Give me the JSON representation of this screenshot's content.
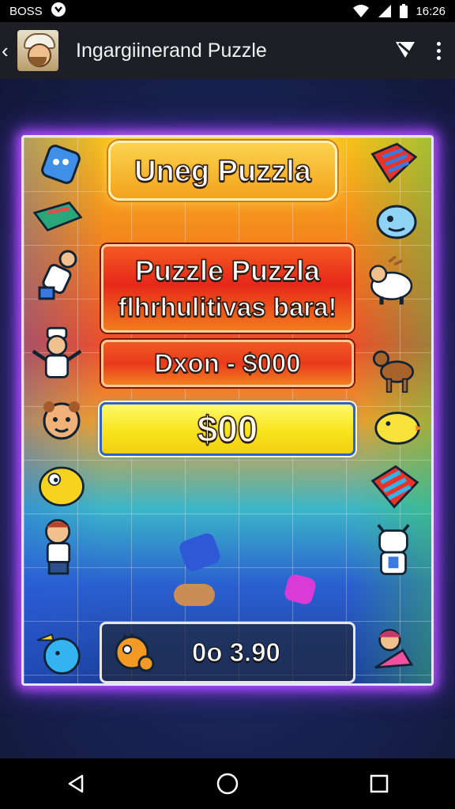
{
  "status_bar": {
    "left_text": "BOSS",
    "time": "16:26",
    "icons": [
      "app-badge-icon",
      "wifi-icon",
      "signal-icon",
      "battery-icon"
    ]
  },
  "app_bar": {
    "title": "Ingargiinerand Puzzle",
    "icons": [
      "back-arrow-icon",
      "avatar",
      "share-icon",
      "more-vert-icon"
    ]
  },
  "game": {
    "title_banner": "Uneg Puzzla",
    "main_banner": {
      "line1": "Puzzle Puzzla",
      "line2": "flhrhulitivas bara!"
    },
    "price_banner": "Dxon - $000",
    "score": "$00",
    "timer": "0o 3.90",
    "left_icons": [
      "dice-icon",
      "kite-icon",
      "rocket-character-icon",
      "chef-character-icon",
      "bear-character-icon",
      "yellow-blob-icon",
      "boy-character-icon",
      "blue-bird-icon"
    ],
    "right_icons": [
      "candy-icon",
      "blue-fish-icon",
      "sheep-icon",
      "deer-icon",
      "yellow-chick-icon",
      "striped-candy-icon",
      "goat-character-icon",
      "girl-character-icon"
    ],
    "colors": {
      "glow": "#b44cff",
      "title_banner": "#f3a21d",
      "main_banner": "#e7281b",
      "score_banner": "#f7e41c"
    }
  },
  "nav_bar": {
    "icons": [
      "back-triangle-icon",
      "home-circle-icon",
      "recents-square-icon"
    ]
  }
}
